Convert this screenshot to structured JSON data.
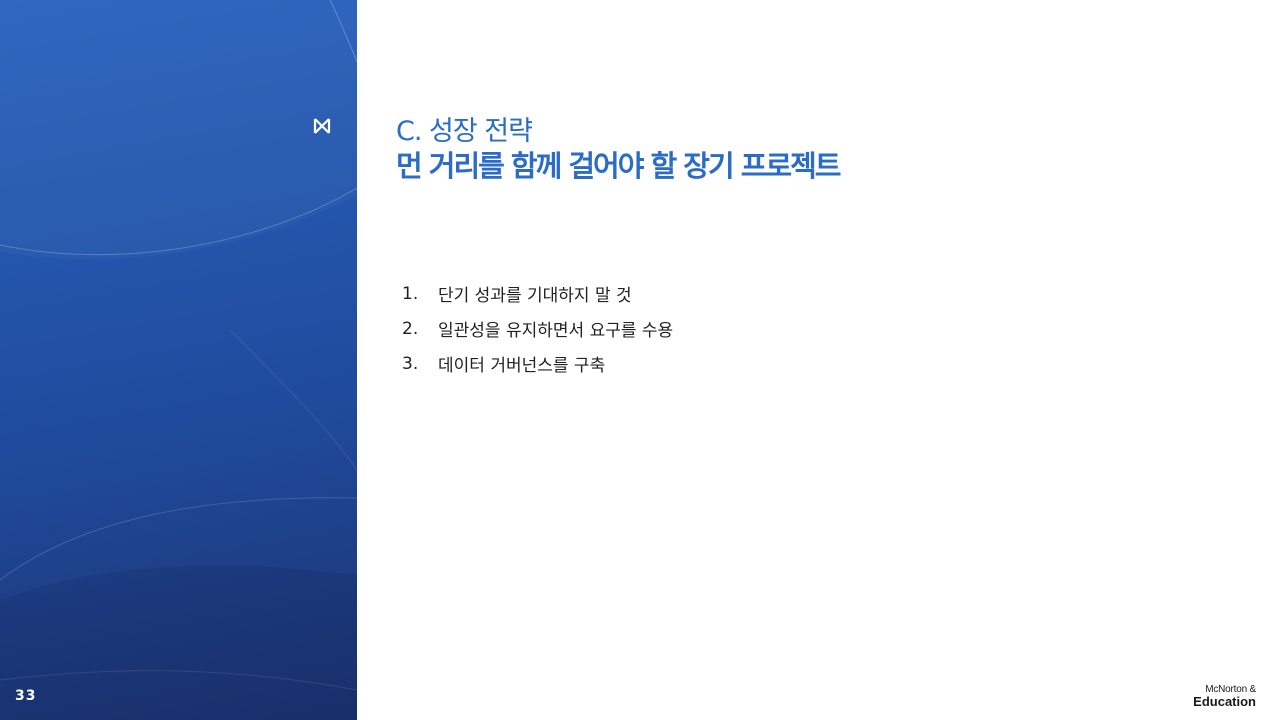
{
  "slide": {
    "page_number": "33",
    "section_title": "C. 성장 전략",
    "main_title": "먼 거리를 함께 걸어야 할 장기 프로젝트",
    "points": [
      {
        "number": "1.",
        "text": "단기 성과를 기대하지 말 것"
      },
      {
        "number": "2.",
        "text": "일관성을 유지하면서 요구를 수용"
      },
      {
        "number": "3.",
        "text": "데이터 거버넌스를 구축"
      }
    ],
    "brand": {
      "line1": "McNorton &",
      "line2": "Education"
    },
    "logo_icon": "m-logo-icon"
  },
  "colors": {
    "accent": "#2b6cc4",
    "panel_top": "#2a63bd",
    "panel_bottom": "#1c326f",
    "body_text": "#222222"
  }
}
